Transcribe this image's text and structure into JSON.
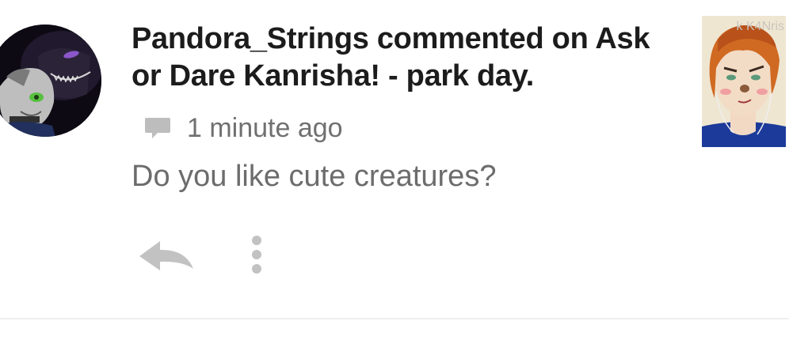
{
  "notification": {
    "username": "Pandora_Strings",
    "action": "commented on",
    "post_title": "Ask or Dare Kanrisha! - park day.",
    "timestamp": "1 minute ago",
    "comment_text": "Do you like cute creatures?",
    "thumbnail_watermark": "k K4Nris"
  },
  "icons": {
    "comment": "comment-bubble-icon",
    "reply": "reply-arrow-icon",
    "more": "more-vertical-icon"
  },
  "colors": {
    "headline": "#1c1c1c",
    "secondary_text": "#707070",
    "icon_gray": "#c2c2c2",
    "divider": "#eeeeee"
  }
}
